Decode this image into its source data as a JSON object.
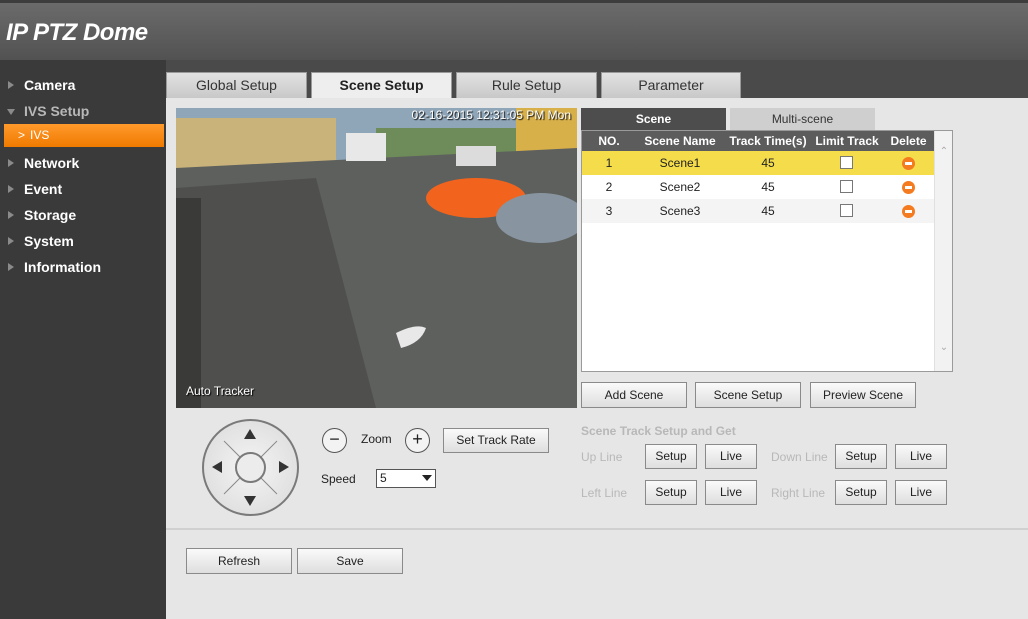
{
  "header": {
    "title": "IP PTZ Dome"
  },
  "sidebar": {
    "items": [
      {
        "label": "Camera"
      },
      {
        "label": "IVS Setup"
      },
      {
        "label": "IVS"
      },
      {
        "label": "Network"
      },
      {
        "label": "Event"
      },
      {
        "label": "Storage"
      },
      {
        "label": "System"
      },
      {
        "label": "Information"
      }
    ]
  },
  "tabs": [
    {
      "label": "Global Setup"
    },
    {
      "label": "Scene Setup"
    },
    {
      "label": "Rule Setup"
    },
    {
      "label": "Parameter"
    }
  ],
  "video": {
    "timestamp": "02-16-2015 12:31:05 PM Mon",
    "mode": "Auto Tracker"
  },
  "scene_tabs": [
    {
      "label": "Scene"
    },
    {
      "label": "Multi-scene"
    }
  ],
  "scene_table": {
    "headers": [
      "NO.",
      "Scene Name",
      "Track Time(s)",
      "Limit Track",
      "Delete"
    ],
    "rows": [
      {
        "no": "1",
        "name": "Scene1",
        "time": "45"
      },
      {
        "no": "2",
        "name": "Scene2",
        "time": "45"
      },
      {
        "no": "3",
        "name": "Scene3",
        "time": "45"
      }
    ]
  },
  "scene_buttons": {
    "add": "Add Scene",
    "setup": "Scene Setup",
    "preview": "Preview Scene"
  },
  "ptz": {
    "zoom_label": "Zoom",
    "zoom_out": "−",
    "zoom_in": "+",
    "set_track_rate": "Set Track Rate",
    "speed_label": "Speed",
    "speed_value": "5"
  },
  "track": {
    "title": "Scene Track Setup and Get",
    "up_line": "Up Line",
    "down_line": "Down Line",
    "left_line": "Left Line",
    "right_line": "Right Line",
    "setup": "Setup",
    "live": "Live"
  },
  "footer": {
    "refresh": "Refresh",
    "save": "Save"
  }
}
